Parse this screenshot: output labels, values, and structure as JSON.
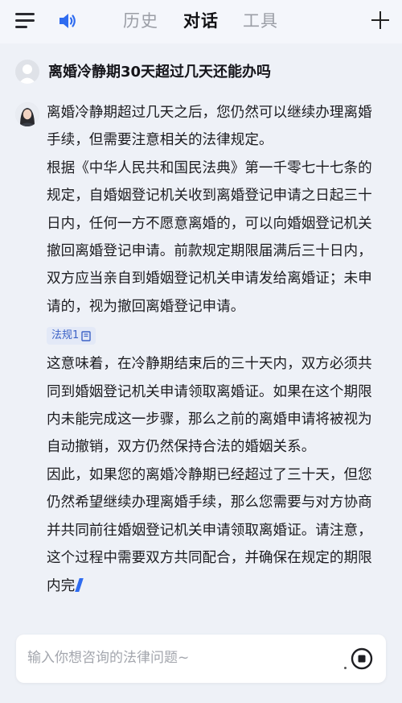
{
  "header": {
    "menu_icon": "menu-icon",
    "speaker_icon": "speaker-icon",
    "tabs": [
      {
        "label": "历史",
        "active": false
      },
      {
        "label": "对话",
        "active": true
      },
      {
        "label": "工具",
        "active": false
      }
    ],
    "plus_icon": "plus-icon",
    "accent_color": "#2f6cf0"
  },
  "question": {
    "avatar_icon": "user-avatar-icon",
    "text": "离婚冷静期30天超过几天还能办吗"
  },
  "answer": {
    "avatar_icon": "assistant-avatar-icon",
    "paragraphs": [
      "离婚冷静期超过几天之后，您仍然可以继续办理离婚手续，但需要注意相关的法律规定。",
      "根据《中华人民共和国民法典》第一千零七十七条的规定，自婚姻登记机关收到离婚登记申请之日起三十日内，任何一方不愿意离婚的，可以向婚姻登记机关撤回离婚登记申请。前款规定期限届满后三十日内，双方应当亲自到婚姻登记机关申请发给离婚证；未申请的，视为撤回离婚登记申请。"
    ],
    "citation_tag": "法规1",
    "citation_icon": "book-icon",
    "paragraphs_after": [
      "这意味着，在冷静期结束后的三十天内，双方必须共同到婚姻登记机关申请领取离婚证。如果在这个期限内未能完成这一步骤，那么之前的离婚申请将被视为自动撤销，双方仍然保持合法的婚姻关系。",
      "因此，如果您的离婚冷静期已经超过了三十天，但您仍然希望继续办理离婚手续，那么您需要与对方协商并共同前往婚姻登记机关申请领取离婚证。请注意，这个过程中需要双方共同配合，并确保在规定的期限内完"
    ]
  },
  "input": {
    "placeholder": "输入你想咨询的法律问题~",
    "stop_icon": "stop-icon"
  }
}
